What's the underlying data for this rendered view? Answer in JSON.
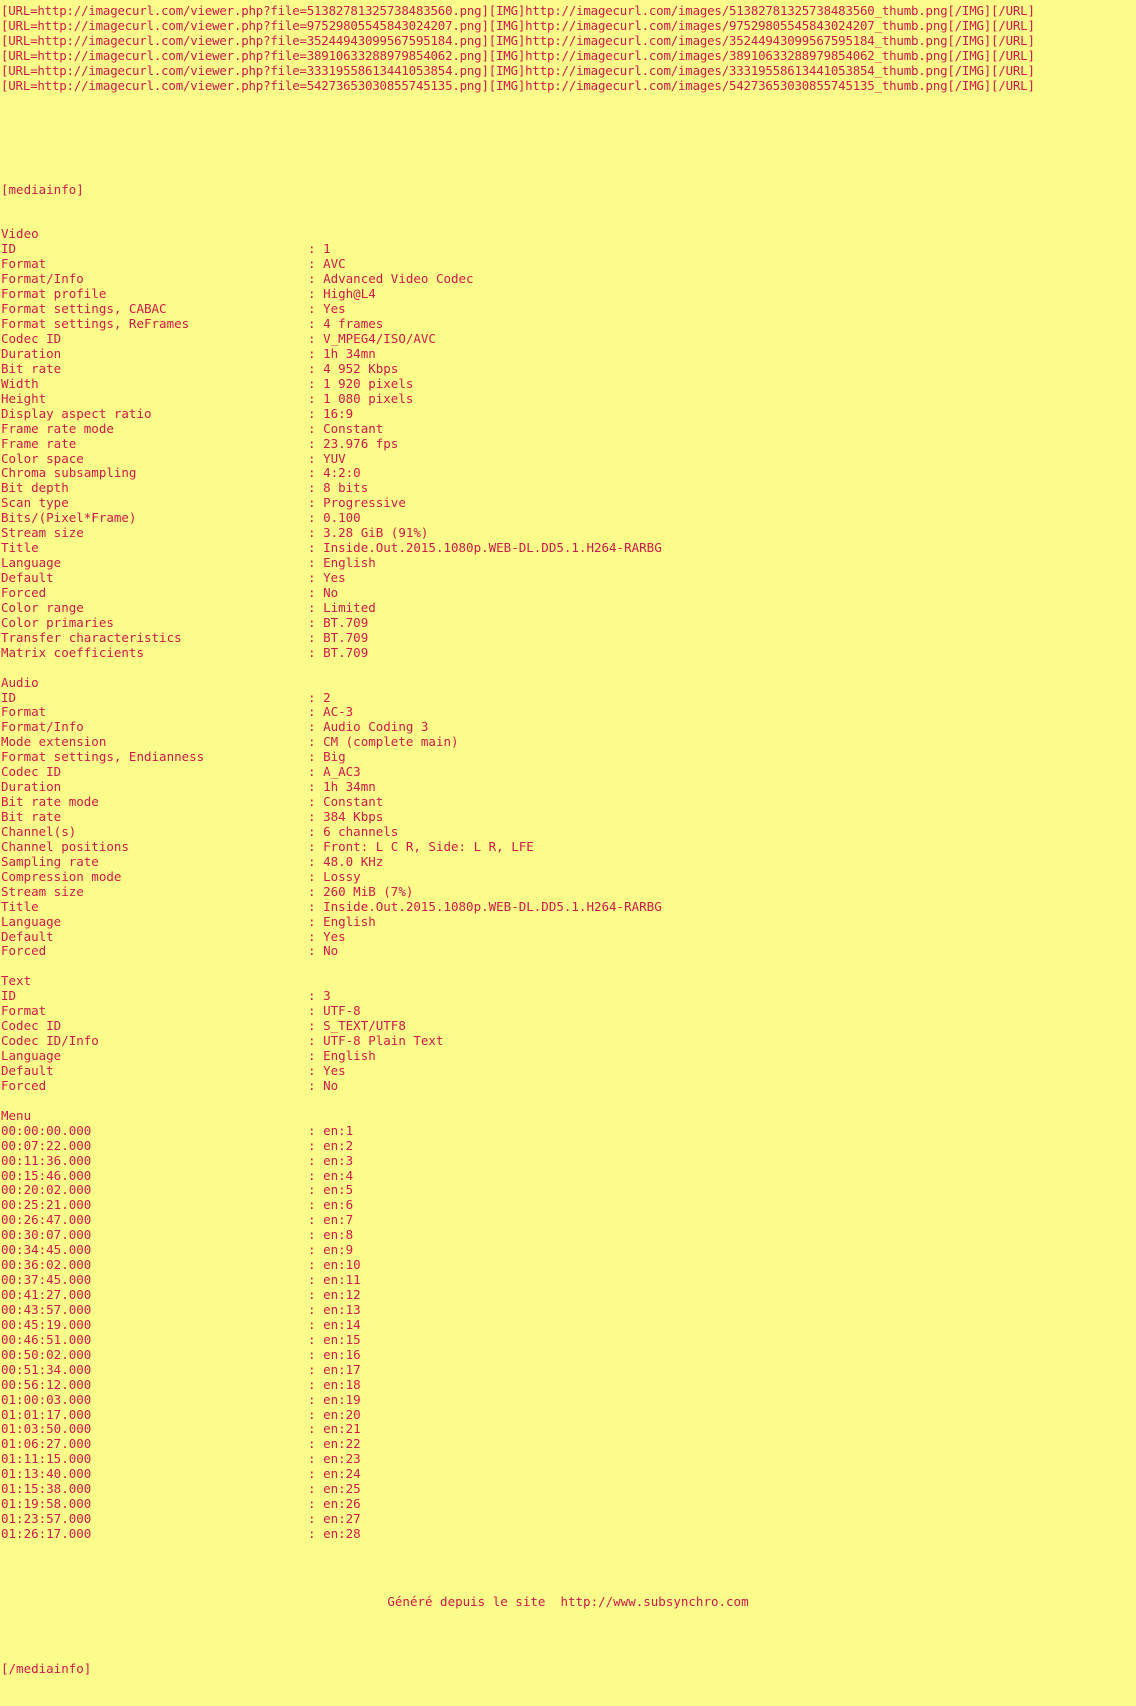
{
  "colors": {
    "background": "#FCFC8A",
    "text": "#D1184A"
  },
  "bbcode_urls": [
    "[URL=http://imagecurl.com/viewer.php?file=51382781325738483560.png][IMG]http://imagecurl.com/images/51382781325738483560_thumb.png[/IMG][/URL]",
    "[URL=http://imagecurl.com/viewer.php?file=97529805545843024207.png][IMG]http://imagecurl.com/images/97529805545843024207_thumb.png[/IMG][/URL]",
    "[URL=http://imagecurl.com/viewer.php?file=35244943099567595184.png][IMG]http://imagecurl.com/images/35244943099567595184_thumb.png[/IMG][/URL]",
    "[URL=http://imagecurl.com/viewer.php?file=38910633288979854062.png][IMG]http://imagecurl.com/images/38910633288979854062_thumb.png[/IMG][/URL]",
    "[URL=http://imagecurl.com/viewer.php?file=33319558613441053854.png][IMG]http://imagecurl.com/images/33319558613441053854_thumb.png[/IMG][/URL]",
    "[URL=http://imagecurl.com/viewer.php?file=54273653030855745135.png][IMG]http://imagecurl.com/images/54273653030855745135_thumb.png[/IMG][/URL]"
  ],
  "mediainfo": {
    "open_tag": "[mediainfo]",
    "close_tag": "[/mediainfo]",
    "sections": [
      {
        "name": "Video",
        "rows": [
          {
            "key": "ID",
            "value": "1"
          },
          {
            "key": "Format",
            "value": "AVC"
          },
          {
            "key": "Format/Info",
            "value": "Advanced Video Codec"
          },
          {
            "key": "Format profile",
            "value": "High@L4"
          },
          {
            "key": "Format settings, CABAC",
            "value": "Yes"
          },
          {
            "key": "Format settings, ReFrames",
            "value": "4 frames"
          },
          {
            "key": "Codec ID",
            "value": "V_MPEG4/ISO/AVC"
          },
          {
            "key": "Duration",
            "value": "1h 34mn"
          },
          {
            "key": "Bit rate",
            "value": "4 952 Kbps"
          },
          {
            "key": "Width",
            "value": "1 920 pixels"
          },
          {
            "key": "Height",
            "value": "1 080 pixels"
          },
          {
            "key": "Display aspect ratio",
            "value": "16:9"
          },
          {
            "key": "Frame rate mode",
            "value": "Constant"
          },
          {
            "key": "Frame rate",
            "value": "23.976 fps"
          },
          {
            "key": "Color space",
            "value": "YUV"
          },
          {
            "key": "Chroma subsampling",
            "value": "4:2:0"
          },
          {
            "key": "Bit depth",
            "value": "8 bits"
          },
          {
            "key": "Scan type",
            "value": "Progressive"
          },
          {
            "key": "Bits/(Pixel*Frame)",
            "value": "0.100"
          },
          {
            "key": "Stream size",
            "value": "3.28 GiB (91%)"
          },
          {
            "key": "Title",
            "value": "Inside.Out.2015.1080p.WEB-DL.DD5.1.H264-RARBG"
          },
          {
            "key": "Language",
            "value": "English"
          },
          {
            "key": "Default",
            "value": "Yes"
          },
          {
            "key": "Forced",
            "value": "No"
          },
          {
            "key": "Color range",
            "value": "Limited"
          },
          {
            "key": "Color primaries",
            "value": "BT.709"
          },
          {
            "key": "Transfer characteristics",
            "value": "BT.709"
          },
          {
            "key": "Matrix coefficients",
            "value": "BT.709"
          }
        ]
      },
      {
        "name": "Audio",
        "rows": [
          {
            "key": "ID",
            "value": "2"
          },
          {
            "key": "Format",
            "value": "AC-3"
          },
          {
            "key": "Format/Info",
            "value": "Audio Coding 3"
          },
          {
            "key": "Mode extension",
            "value": "CM (complete main)"
          },
          {
            "key": "Format settings, Endianness",
            "value": "Big"
          },
          {
            "key": "Codec ID",
            "value": "A_AC3"
          },
          {
            "key": "Duration",
            "value": "1h 34mn"
          },
          {
            "key": "Bit rate mode",
            "value": "Constant"
          },
          {
            "key": "Bit rate",
            "value": "384 Kbps"
          },
          {
            "key": "Channel(s)",
            "value": "6 channels"
          },
          {
            "key": "Channel positions",
            "value": "Front: L C R, Side: L R, LFE"
          },
          {
            "key": "Sampling rate",
            "value": "48.0 KHz"
          },
          {
            "key": "Compression mode",
            "value": "Lossy"
          },
          {
            "key": "Stream size",
            "value": "260 MiB (7%)"
          },
          {
            "key": "Title",
            "value": "Inside.Out.2015.1080p.WEB-DL.DD5.1.H264-RARBG"
          },
          {
            "key": "Language",
            "value": "English"
          },
          {
            "key": "Default",
            "value": "Yes"
          },
          {
            "key": "Forced",
            "value": "No"
          }
        ]
      },
      {
        "name": "Text",
        "rows": [
          {
            "key": "ID",
            "value": "3"
          },
          {
            "key": "Format",
            "value": "UTF-8"
          },
          {
            "key": "Codec ID",
            "value": "S_TEXT/UTF8"
          },
          {
            "key": "Codec ID/Info",
            "value": "UTF-8 Plain Text"
          },
          {
            "key": "Language",
            "value": "English"
          },
          {
            "key": "Default",
            "value": "Yes"
          },
          {
            "key": "Forced",
            "value": "No"
          }
        ]
      },
      {
        "name": "Menu",
        "rows": [
          {
            "key": "00:00:00.000",
            "value": "en:1"
          },
          {
            "key": "00:07:22.000",
            "value": "en:2"
          },
          {
            "key": "00:11:36.000",
            "value": "en:3"
          },
          {
            "key": "00:15:46.000",
            "value": "en:4"
          },
          {
            "key": "00:20:02.000",
            "value": "en:5"
          },
          {
            "key": "00:25:21.000",
            "value": "en:6"
          },
          {
            "key": "00:26:47.000",
            "value": "en:7"
          },
          {
            "key": "00:30:07.000",
            "value": "en:8"
          },
          {
            "key": "00:34:45.000",
            "value": "en:9"
          },
          {
            "key": "00:36:02.000",
            "value": "en:10"
          },
          {
            "key": "00:37:45.000",
            "value": "en:11"
          },
          {
            "key": "00:41:27.000",
            "value": "en:12"
          },
          {
            "key": "00:43:57.000",
            "value": "en:13"
          },
          {
            "key": "00:45:19.000",
            "value": "en:14"
          },
          {
            "key": "00:46:51.000",
            "value": "en:15"
          },
          {
            "key": "00:50:02.000",
            "value": "en:16"
          },
          {
            "key": "00:51:34.000",
            "value": "en:17"
          },
          {
            "key": "00:56:12.000",
            "value": "en:18"
          },
          {
            "key": "01:00:03.000",
            "value": "en:19"
          },
          {
            "key": "01:01:17.000",
            "value": "en:20"
          },
          {
            "key": "01:03:50.000",
            "value": "en:21"
          },
          {
            "key": "01:06:27.000",
            "value": "en:22"
          },
          {
            "key": "01:11:15.000",
            "value": "en:23"
          },
          {
            "key": "01:13:40.000",
            "value": "en:24"
          },
          {
            "key": "01:15:38.000",
            "value": "en:25"
          },
          {
            "key": "01:19:58.000",
            "value": "en:26"
          },
          {
            "key": "01:23:57.000",
            "value": "en:27"
          },
          {
            "key": "01:26:17.000",
            "value": "en:28"
          }
        ]
      }
    ]
  },
  "footer": {
    "text": "Généré depuis le site  http://www.subsynchro.com"
  }
}
